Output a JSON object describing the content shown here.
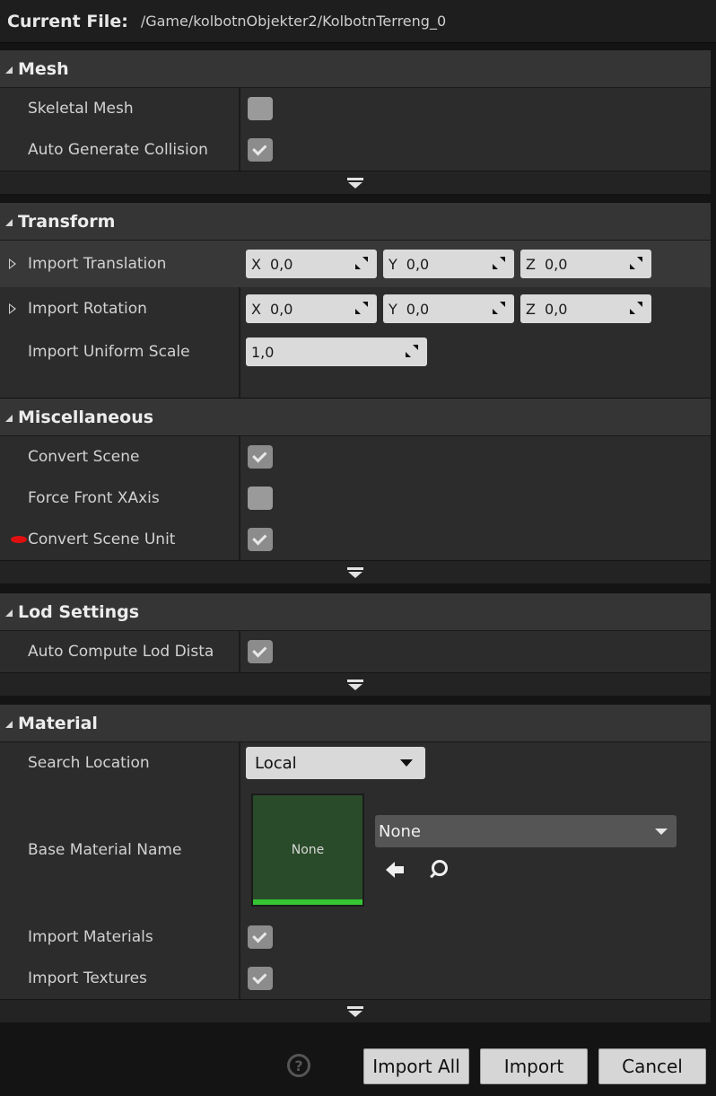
{
  "header": {
    "label": "Current File:",
    "path": "/Game/kolbotnObjekter2/KolbotnTerreng_0"
  },
  "mesh": {
    "title": "Mesh",
    "skeletal_mesh": {
      "label": "Skeletal Mesh",
      "checked": false
    },
    "auto_generate_collision": {
      "label": "Auto Generate Collision",
      "checked": true
    }
  },
  "transform": {
    "title": "Transform",
    "import_translation": {
      "label": "Import Translation",
      "x_axis": "X",
      "x": "0,0",
      "y_axis": "Y",
      "y": "0,0",
      "z_axis": "Z",
      "z": "0,0"
    },
    "import_rotation": {
      "label": "Import Rotation",
      "x_axis": "X",
      "x": "0,0",
      "y_axis": "Y",
      "y": "0,0",
      "z_axis": "Z",
      "z": "0,0"
    },
    "import_uniform_scale": {
      "label": "Import Uniform Scale",
      "value": "1,0"
    }
  },
  "misc": {
    "title": "Miscellaneous",
    "convert_scene": {
      "label": "Convert Scene",
      "checked": true
    },
    "force_front_xaxis": {
      "label": "Force Front XAxis",
      "checked": false
    },
    "convert_scene_unit": {
      "label": "Convert Scene Unit",
      "checked": true
    }
  },
  "lod": {
    "title": "Lod Settings",
    "auto_compute_lod": {
      "label": "Auto Compute Lod Dista",
      "checked": true
    }
  },
  "material": {
    "title": "Material",
    "search_location": {
      "label": "Search Location",
      "value": "Local"
    },
    "base_material_name": {
      "label": "Base Material Name",
      "thumbnail_text": "None",
      "asset_value": "None"
    },
    "import_materials": {
      "label": "Import Materials",
      "checked": true
    },
    "import_textures": {
      "label": "Import Textures",
      "checked": true
    }
  },
  "footer": {
    "help_glyph": "?",
    "import_all": "Import All",
    "import": "Import",
    "cancel": "Cancel"
  },
  "colors": {
    "background": "#141414",
    "section_header": "#353535",
    "section_body": "#2c2c2c",
    "thumbnail_green": "#2a4b2a",
    "thumbnail_bar": "#34c434",
    "modified_marker": "#e01010"
  }
}
